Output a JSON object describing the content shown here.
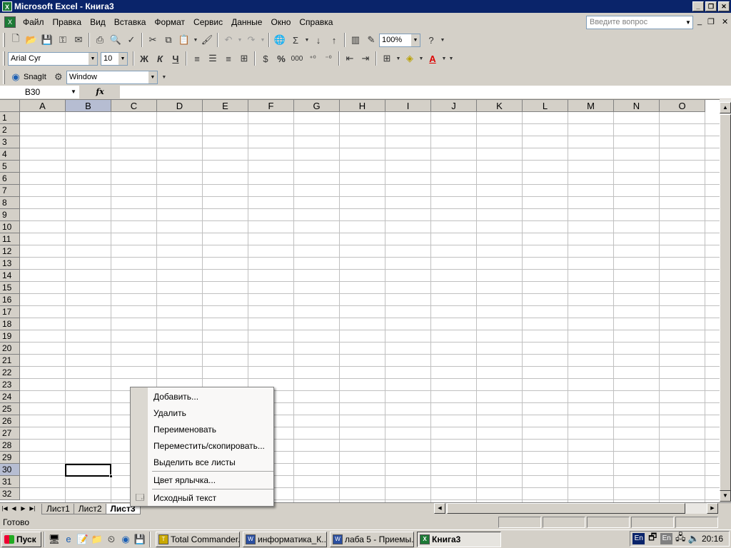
{
  "window": {
    "title": "Microsoft Excel - Книга3",
    "caption_buttons": [
      "_",
      "❐",
      "✕"
    ]
  },
  "menubar": {
    "items": [
      "Файл",
      "Правка",
      "Вид",
      "Вставка",
      "Формат",
      "Сервис",
      "Данные",
      "Окно",
      "Справка"
    ],
    "ask_placeholder": "Введите вопрос",
    "doc_controls": [
      "_",
      "❐",
      "✕"
    ]
  },
  "toolbar_standard": {
    "zoom": "100%"
  },
  "toolbar_formatting": {
    "font": "Arial Cyr",
    "size": "10",
    "bold": "Ж",
    "italic": "К",
    "underline": "Ч",
    "percent": "%",
    "thousands": "000"
  },
  "toolbar_snagit": {
    "label": "SnagIt",
    "capture_mode": "Window"
  },
  "formula_bar": {
    "name_box": "B30",
    "fx": "fx",
    "content": ""
  },
  "grid": {
    "columns": [
      "A",
      "B",
      "C",
      "D",
      "E",
      "F",
      "G",
      "H",
      "I",
      "J",
      "K",
      "L",
      "M",
      "N",
      "O"
    ],
    "rows": [
      "1",
      "2",
      "3",
      "4",
      "5",
      "6",
      "7",
      "8",
      "9",
      "10",
      "11",
      "12",
      "13",
      "14",
      "15",
      "16",
      "17",
      "18",
      "19",
      "20",
      "21",
      "22",
      "23",
      "24",
      "25",
      "26",
      "27",
      "28",
      "29",
      "30",
      "31",
      "32"
    ],
    "selected_column": "B",
    "selected_row": "30"
  },
  "sheet_tabs": {
    "tabs": [
      "Лист1",
      "Лист2",
      "Лист3"
    ],
    "active": "Лист3"
  },
  "context_menu": {
    "items": [
      "Добавить...",
      "Удалить",
      "Переименовать",
      "Переместить/скопировать...",
      "Выделить все листы"
    ],
    "items2": [
      "Цвет ярлычка..."
    ],
    "items3": [
      "Исходный текст"
    ]
  },
  "status": {
    "text": "Готово"
  },
  "taskbar": {
    "start": "Пуск",
    "buttons": [
      "Total Commander...",
      "информатика_К...",
      "лаба 5 - Приемы...",
      "Книга3"
    ],
    "active": "Книга3",
    "lang1": "En",
    "lang2": "En",
    "clock": "20:16"
  }
}
